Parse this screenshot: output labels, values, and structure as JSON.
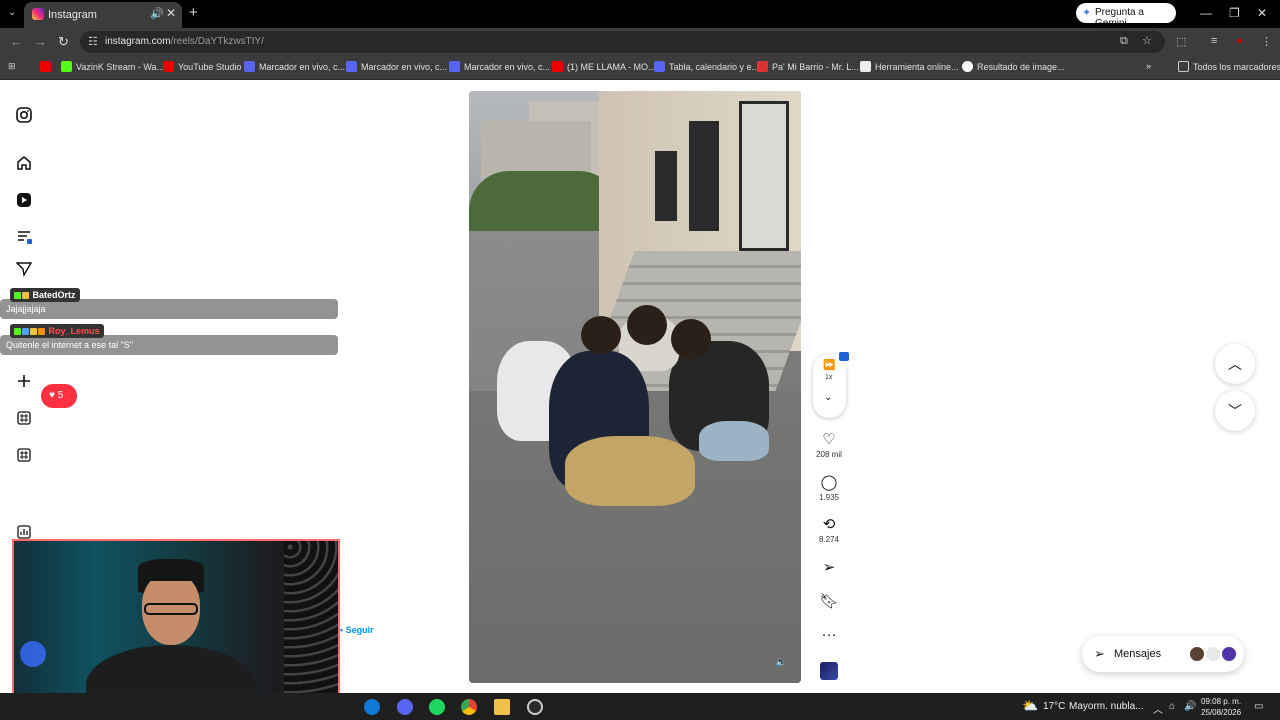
{
  "browser": {
    "tab_title": "Instagram",
    "gemini_label": "Pregunta a Gemini",
    "url_host": "instagram.com",
    "url_path": "/reels/DaYTkzwsTIY/",
    "bookmarks": [
      "VazinK Stream - Wa...",
      "YouTube Studio",
      "Marcador en vivo, c...",
      "Marcador en vivo, c...",
      "Marcador en vivo, c...",
      "(1) ME LLAMA - MO...",
      "Tabla, calendario y e...",
      "Pa' Mi Barrio - Mr. L...",
      "Herramienta online...",
      "Resultado de image..."
    ],
    "all_bookmarks": "Todos los marcadores"
  },
  "chat": [
    {
      "user": "BatedOrtz",
      "message": "Jajajjajaja"
    },
    {
      "user": "Roy_Lemus",
      "message": "Quitenle el internet a ese tal \"S\""
    }
  ],
  "likes_overlay": "5",
  "reel": {
    "speed": "1x",
    "likes": "208 mil",
    "comments": "1.935",
    "reposts": "8.274",
    "follow": "• Seguir"
  },
  "messages_label": "Mensajes",
  "taskbar": {
    "weather": "17°C",
    "weather_desc": "Mayorm. nubla...",
    "time": "09:08 p. m.",
    "date": "25/08/2026"
  },
  "colors": {
    "instagram_red": "#ff3040",
    "link_blue": "#0095f6",
    "chrome_dark": "#3c3c3c"
  }
}
